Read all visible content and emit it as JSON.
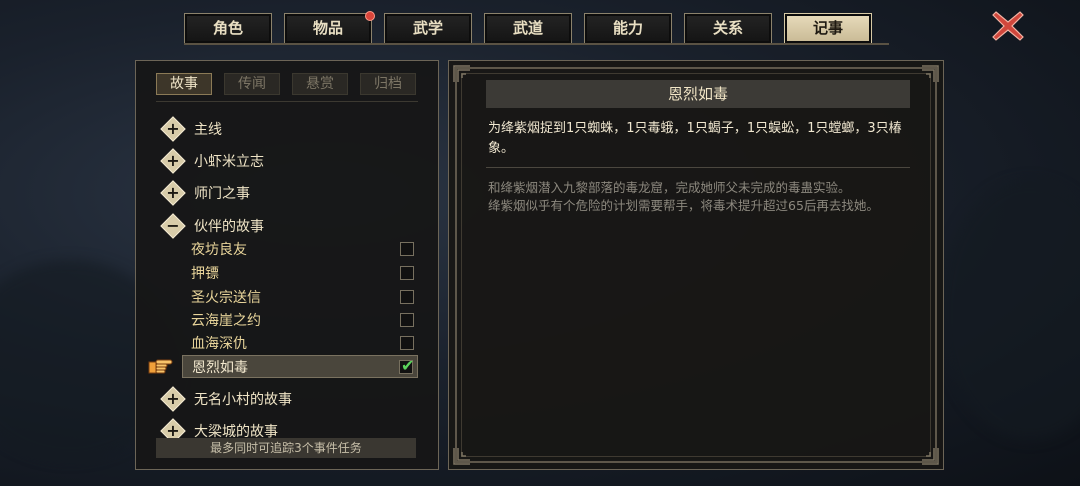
{
  "tabs": [
    {
      "label": "角色",
      "active": false,
      "badge": false
    },
    {
      "label": "物品",
      "active": false,
      "badge": true
    },
    {
      "label": "武学",
      "active": false,
      "badge": false
    },
    {
      "label": "武道",
      "active": false,
      "badge": false
    },
    {
      "label": "能力",
      "active": false,
      "badge": false
    },
    {
      "label": "关系",
      "active": false,
      "badge": false
    },
    {
      "label": "记事",
      "active": true,
      "badge": false
    }
  ],
  "close_icon": "close-x-icon",
  "subtabs": [
    {
      "label": "故事",
      "active": true
    },
    {
      "label": "传闻",
      "active": false
    },
    {
      "label": "悬赏",
      "active": false
    },
    {
      "label": "归档",
      "active": false
    }
  ],
  "groups": [
    {
      "label": "主线",
      "expanded": false
    },
    {
      "label": "小虾米立志",
      "expanded": false
    },
    {
      "label": "师门之事",
      "expanded": false
    },
    {
      "label": "伙伴的故事",
      "expanded": true
    },
    {
      "label": "无名小村的故事",
      "expanded": false
    },
    {
      "label": "大梁城的故事",
      "expanded": false
    }
  ],
  "quests": [
    {
      "label": "夜坊良友",
      "tracked": false,
      "selected": false
    },
    {
      "label": "押镖",
      "tracked": false,
      "selected": false
    },
    {
      "label": "圣火宗送信",
      "tracked": false,
      "selected": false
    },
    {
      "label": "云海崖之约",
      "tracked": false,
      "selected": false
    },
    {
      "label": "血海深仇",
      "tracked": false,
      "selected": false
    },
    {
      "label": "恩烈如毒",
      "tracked": true,
      "selected": true
    }
  ],
  "tracking_note": "最多同时可追踪3个事件任务",
  "detail": {
    "title": "恩烈如毒",
    "objective": "为绛紫烟捉到1只蜘蛛，1只毒蛾，1只蝎子，1只蜈蚣，1只螳螂，3只椿象。",
    "description_line1": "和绛紫烟潜入九黎部落的毒龙窟，完成她师父未完成的毒蛊实验。",
    "description_line2": "绛紫烟似乎有个危险的计划需要帮手，将毒术提升超过65后再去找她。"
  },
  "colors": {
    "accent": "#d8cca9",
    "check": "#5bd35b",
    "close": "#d9453b"
  }
}
